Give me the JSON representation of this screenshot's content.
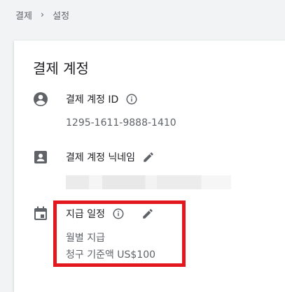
{
  "breadcrumb": {
    "items": [
      "결제",
      "설정"
    ],
    "separator": "›"
  },
  "card": {
    "title": "결제 계정",
    "account_id": {
      "label": "결제 계정 ID",
      "value": "1295-1611-9888-1410"
    },
    "nickname": {
      "label": "결제 계정 닉네임"
    },
    "payment_schedule": {
      "label": "지급 일정",
      "frequency": "월별 지급",
      "threshold": "청구 기준액 US$100"
    }
  },
  "colors": {
    "highlight": "#e3181f",
    "icon": "#5f6368",
    "muted_text": "#5f6368"
  },
  "icons": [
    "account-circle-icon",
    "contact-card-icon",
    "calendar-icon",
    "info-icon",
    "pencil-icon"
  ]
}
